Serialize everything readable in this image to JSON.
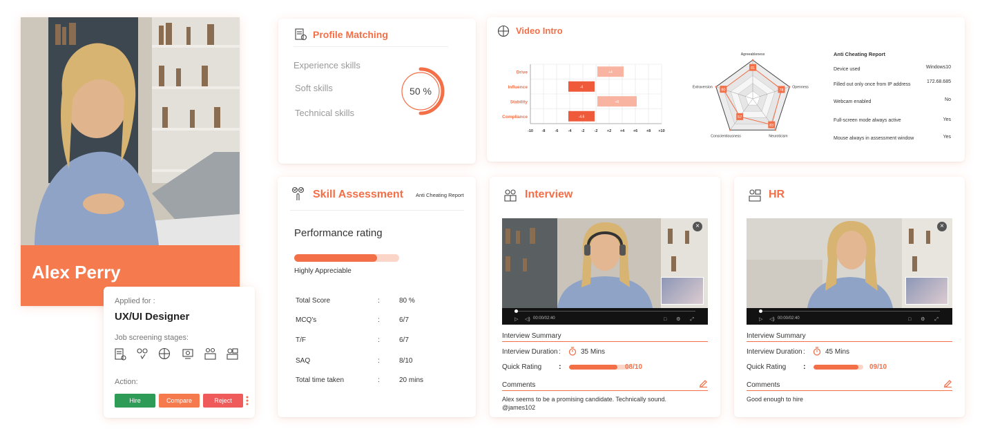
{
  "candidate": {
    "name": "Alex Perry"
  },
  "applied": {
    "label": "Applied for :",
    "role": "UX/UI Designer",
    "stages_label": "Job screening stages:",
    "action_label": "Action:",
    "buttons": {
      "hire": "Hire",
      "compare": "Compare",
      "reject": "Reject"
    },
    "colors": {
      "hire": "#2e9c57",
      "compare": "#f57b4f",
      "reject": "#ef5b5b"
    }
  },
  "profile_matching": {
    "title": "Profile Matching",
    "skills": [
      "Experience skills",
      "Soft skills",
      "Technical skills"
    ],
    "score_label": "50 %",
    "score": 0.5
  },
  "video_intro": {
    "title": "Video Intro",
    "bar_chart": {
      "categories": [
        "Drive",
        "Influence",
        "Stability",
        "Compliance"
      ],
      "values": [
        4,
        -4,
        6,
        -4
      ],
      "value_labels": [
        "+4",
        "-4",
        "+6",
        "-4.6"
      ],
      "ticks": [
        "-10",
        "-8",
        "-6",
        "-4",
        "-2",
        "-2",
        "+2",
        "+4",
        "+6",
        "+8",
        "+10"
      ]
    },
    "radar": {
      "axes": [
        "Agreeableness",
        "Openness",
        "Neuroticism",
        "Conscientiousness",
        "Extraversion"
      ],
      "values": [
        81,
        78,
        83,
        57,
        80
      ],
      "value_labels": [
        "81",
        "78",
        "83",
        "57",
        "80"
      ]
    },
    "anti_cheating": {
      "title": "Anti Cheating Report",
      "rows": [
        {
          "label": "Device used",
          "value": "Windows10"
        },
        {
          "label": "Filled out only once from IP address",
          "value": "172.68.685"
        },
        {
          "label": "Webcam enabled",
          "value": "No"
        },
        {
          "label": "Full-screen mode always active",
          "value": "Yes"
        },
        {
          "label": "Mouse always in assessment window",
          "value": "Yes"
        }
      ]
    }
  },
  "skill_assessment": {
    "title": "Skill Assessment",
    "link": "Anti Cheating Report",
    "rating_title": "Performance rating",
    "rating_fraction": 0.79,
    "rating_label": "Highly Appreciable",
    "rows": [
      {
        "label": "Total Score",
        "colon": ":",
        "value": "80 %"
      },
      {
        "label": "MCQ's",
        "colon": ":",
        "value": "6/7"
      },
      {
        "label": "T/F",
        "colon": ":",
        "value": "6/7"
      },
      {
        "label": "SAQ",
        "colon": ":",
        "value": "8/10"
      },
      {
        "label": "Total time taken",
        "colon": ":",
        "value": "20 mins"
      }
    ]
  },
  "interview": {
    "title": "Interview",
    "time": "00:00/02:40",
    "summary_label": "Interview Summary",
    "duration_label": "Interview Duration",
    "duration_colon": ":",
    "duration_value": "35 Mins",
    "rating_label": "Quick Rating",
    "rating_colon": ":",
    "rating_value": "08/10",
    "rating_fraction": 0.8,
    "comments_label": "Comments",
    "comment": "Alex seems to be a promising candidate. Technically sound.",
    "comment_author": "@james102"
  },
  "hr": {
    "title": "HR",
    "time": "00:00/02:40",
    "summary_label": "Interview Summary",
    "duration_label": "Interview Duration",
    "duration_colon": ":",
    "duration_value": "45 Mins",
    "rating_label": "Quick Rating",
    "rating_colon": ":",
    "rating_value": "09/10",
    "rating_fraction": 0.9,
    "comments_label": "Comments",
    "comment": "Good enough to hire"
  },
  "colors": {
    "accent": "#f26f47",
    "accent_light": "#fbd5c7"
  }
}
